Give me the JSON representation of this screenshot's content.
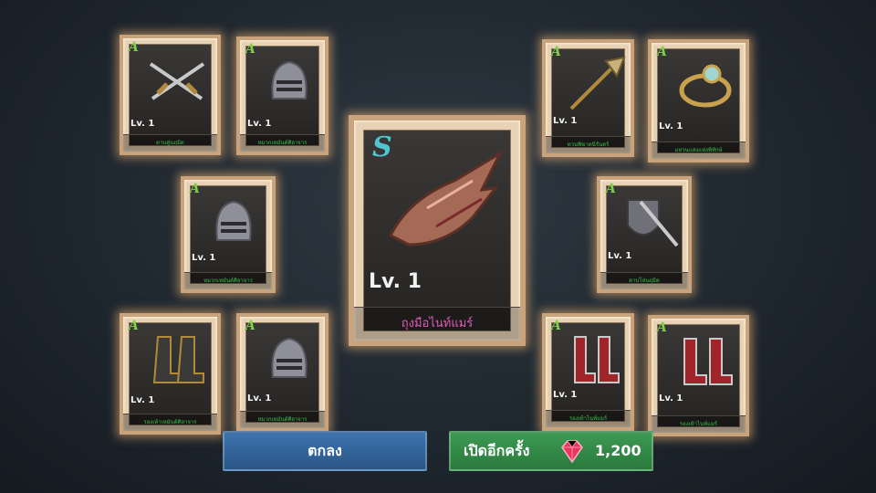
{
  "featured_card": {
    "grade": "S",
    "level": "Lv. 1",
    "name": "ถุงมือไนท์แมร์",
    "grade_color": "#4fc6cf",
    "name_color": "#e05ab8"
  },
  "cards": [
    {
      "grade": "A",
      "level": "Lv. 1",
      "name": "ดาบคู่นฤมิต",
      "item": "crossed-swords"
    },
    {
      "grade": "A",
      "level": "Lv. 1",
      "name": "หมวกเหมันต์ศิลาจาร",
      "item": "helmet"
    },
    {
      "grade": "A",
      "level": "Lv. 1",
      "name": "หมวกเหมันต์ศิลาจาร",
      "item": "helmet"
    },
    {
      "grade": "A",
      "level": "Lv. 1",
      "name": "รองเท้าเหมันต์ศิลาจาร",
      "item": "boots-dark"
    },
    {
      "grade": "A",
      "level": "Lv. 1",
      "name": "หมวกเหมันต์ศิลาจาร",
      "item": "helmet"
    },
    {
      "grade": "A",
      "level": "Lv. 1",
      "name": "ทวนพิฆาตนิรันดร์",
      "item": "halberd"
    },
    {
      "grade": "A",
      "level": "Lv. 1",
      "name": "แหวนแสงแห่งพิทักษ์",
      "item": "ring"
    },
    {
      "grade": "A",
      "level": "Lv. 1",
      "name": "ดาบโล่นฤมิต",
      "item": "sword-shield"
    },
    {
      "grade": "A",
      "level": "Lv. 1",
      "name": "รองเท้าไนท์แมร์",
      "item": "boots-red"
    },
    {
      "grade": "A",
      "level": "Lv. 1",
      "name": "รองเท้าไนท์แมร์",
      "item": "boots-red"
    }
  ],
  "buttons": {
    "ok_label": "ตกลง",
    "open_again_label": "เปิดอีกครั้ง",
    "cost": "1,200",
    "cost_icon": "ruby-gem-icon"
  },
  "colors": {
    "grade_a": "#7fd04a",
    "item_name": "#39c04a",
    "ok_button": "#2f5f95",
    "open_again_button": "#2f8a44"
  }
}
